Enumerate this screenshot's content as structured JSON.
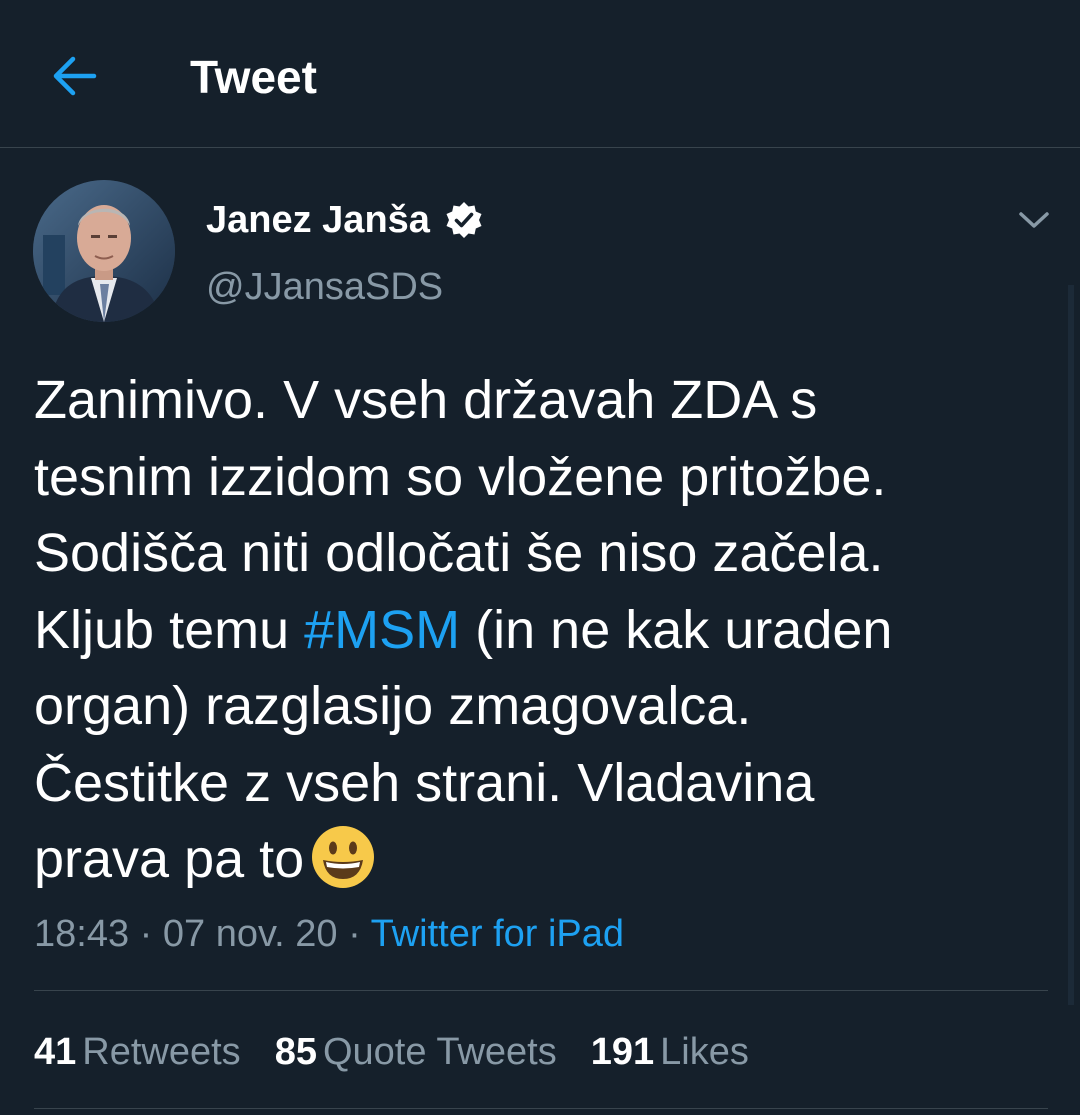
{
  "header": {
    "title": "Tweet",
    "back_icon": "arrow-left-icon"
  },
  "author": {
    "name": "Janez Janša",
    "handle": "@JJansaSDS",
    "verified_icon": "verified-badge-icon",
    "menu_icon": "chevron-down-icon"
  },
  "tweet": {
    "lines": [
      "Zanimivo. V vseh državah ZDA s",
      "tesnim izzidom so vložene pritožbe.",
      "Sodišča niti odločati še niso začela.",
      "Kljub temu ",
      "#MSM",
      " (in ne kak uraden",
      "organ) razglasijo zmagovalca.",
      "Čestitke z vseh strani. Vladavina",
      "prava pa to"
    ],
    "emoji": "grinning-face-emoji"
  },
  "meta": {
    "time": "18:43",
    "sep1": " · ",
    "date": "07 nov. 20",
    "sep2": " · ",
    "source": "Twitter for iPad"
  },
  "stats": [
    {
      "count": "41",
      "label": "Retweets"
    },
    {
      "count": "85",
      "label": "Quote Tweets"
    },
    {
      "count": "191",
      "label": "Likes"
    }
  ],
  "colors": {
    "background": "#15202b",
    "accent": "#1da1f2",
    "secondary_text": "#8899a6",
    "divider": "#38444d"
  }
}
